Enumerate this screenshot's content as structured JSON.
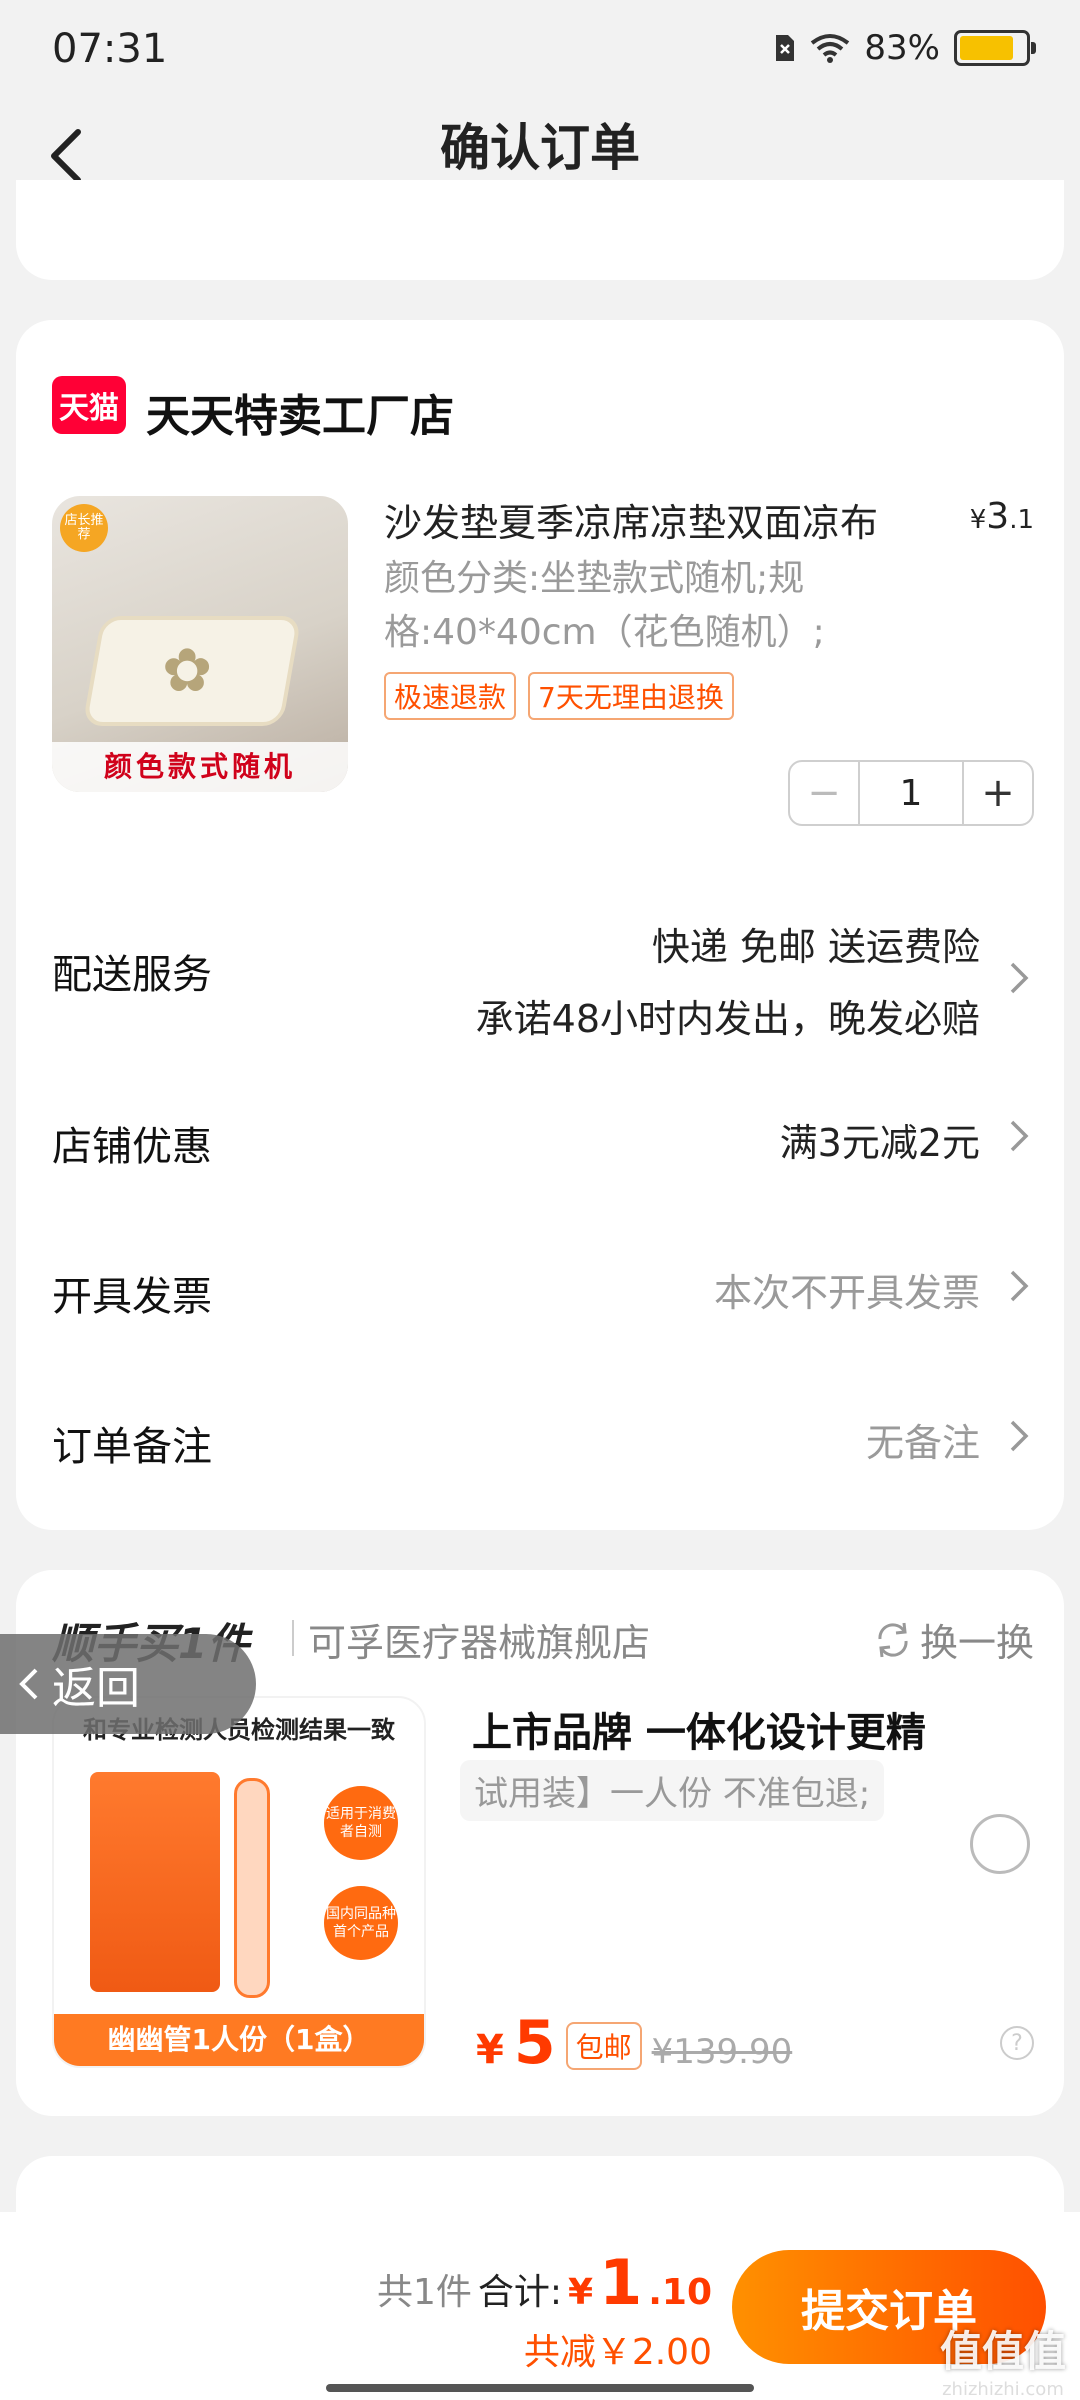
{
  "status": {
    "time": "07:31",
    "battery": "83%",
    "battery_level": 0.83
  },
  "nav": {
    "title": "确认订单"
  },
  "shop": {
    "logo_text": "天猫",
    "name": "天天特卖工厂店",
    "product": {
      "badge": "店长推荐",
      "image_caption": "颜色款式随机",
      "title": "沙发垫夏季凉席凉垫双面凉布",
      "price_currency": "¥",
      "price_int": "3",
      "price_dec": ".1",
      "spec": "颜色分类:坐垫款式随机;规格:40*40cm（花色随机）;",
      "tags": [
        "极速退款",
        "7天无理由退换"
      ],
      "quantity": "1",
      "minus": "−",
      "plus": "+"
    },
    "rows": {
      "delivery_label": "配送服务",
      "delivery_line1": "快递 免邮 送运费险",
      "delivery_line2": "承诺48小时内发出，晚发必赔",
      "discount_label": "店铺优惠",
      "discount_value": "满3元减2元",
      "invoice_label": "开具发票",
      "invoice_value": "本次不开具发票",
      "note_label": "订单备注",
      "note_value": "无备注"
    }
  },
  "addon": {
    "title": "顺手买1件",
    "shop": "可孚医疗器械旗舰店",
    "swap": "换一换",
    "image_headline": "和专业检测人员检测结果一致",
    "bubble1": "适用于消费者自测",
    "bubble2": "国内同品种首个产品",
    "image_footer": "幽幽管1人份（1盒）",
    "line1": "上市品牌 一体化设计更精",
    "line2": "试用装】一人份 不准包退;",
    "price_currency": "¥",
    "price": "5",
    "free_shipping": "包邮",
    "old_price": "¥139.90",
    "help": "?"
  },
  "float_back": {
    "label": "返回"
  },
  "footer": {
    "count": "共1件",
    "total_label": "合计:",
    "total_currency": "¥",
    "total_int": "1",
    "total_dec": ".10",
    "saved": "共减￥2.00",
    "submit": "提交订单"
  },
  "watermark": {
    "line1": "值值值",
    "line2": "zhizhizhi.com"
  },
  "colors": {
    "accent": "#ff5000",
    "tmall": "#ff0036",
    "price": "#ff3a00"
  }
}
